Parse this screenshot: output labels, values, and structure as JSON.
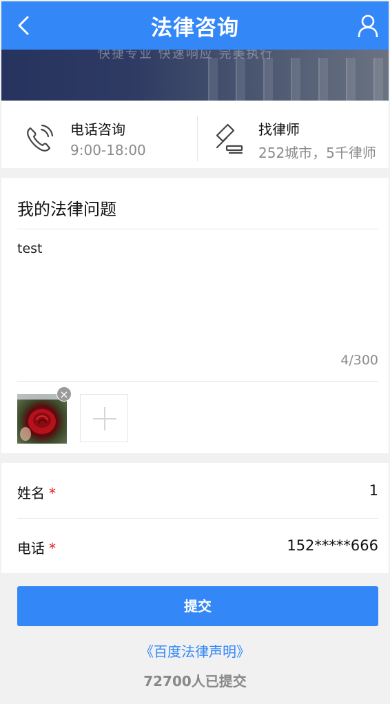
{
  "header": {
    "title": "法律咨询",
    "back_icon": "chevron-left-icon",
    "user_icon": "user-icon"
  },
  "banner": {
    "slogan": "快捷专业   快速响应   完美执行"
  },
  "services": [
    {
      "icon": "phone-icon",
      "title": "电话咨询",
      "subtitle": "9:00-18:00"
    },
    {
      "icon": "gavel-icon",
      "title": "找律师",
      "subtitle": "252城市，5千律师"
    }
  ],
  "question": {
    "heading": "我的法律问题",
    "text": "test",
    "counter": "4/300"
  },
  "form": {
    "name_label": "姓名",
    "name_value": "1",
    "phone_label": "电话",
    "phone_value": "152*****666",
    "required_mark": "*"
  },
  "footer": {
    "submit_label": "提交",
    "legal_link": "《百度法律声明》",
    "submitted_count": "72700人已提交"
  },
  "colors": {
    "primary": "#3487f7",
    "required": "#e02020",
    "muted": "#8a8a8a"
  }
}
